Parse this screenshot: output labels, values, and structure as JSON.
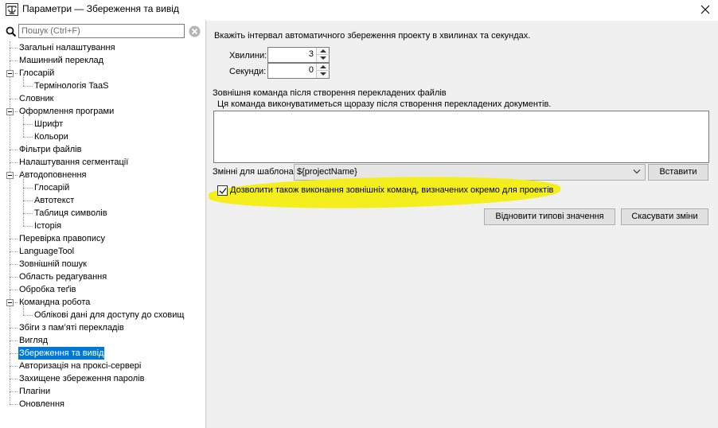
{
  "window": {
    "title": "Параметри — Збереження та вивід",
    "app_icon": "omegat-logo-icon",
    "close_icon": "close-icon"
  },
  "search": {
    "placeholder": "Пошук (Ctrl+F)",
    "value": "",
    "icon": "search-icon",
    "clear_icon": "clear-icon"
  },
  "tree": [
    {
      "label": "Загальні налаштування",
      "level": 0
    },
    {
      "label": "Машинний переклад",
      "level": 0
    },
    {
      "label": "Глосарій",
      "level": 0,
      "expanded": true
    },
    {
      "label": "Термінологія TaaS",
      "level": 1
    },
    {
      "label": "Словник",
      "level": 0
    },
    {
      "label": "Оформлення програми",
      "level": 0,
      "expanded": true
    },
    {
      "label": "Шрифт",
      "level": 1
    },
    {
      "label": "Кольори",
      "level": 1
    },
    {
      "label": "Фільтри файлів",
      "level": 0
    },
    {
      "label": "Налаштування сегментації",
      "level": 0
    },
    {
      "label": "Автодоповнення",
      "level": 0,
      "expanded": true
    },
    {
      "label": "Глосарій",
      "level": 1
    },
    {
      "label": "Автотекст",
      "level": 1
    },
    {
      "label": "Таблиця символів",
      "level": 1
    },
    {
      "label": "Історія",
      "level": 1
    },
    {
      "label": "Перевірка правопису",
      "level": 0
    },
    {
      "label": "LanguageTool",
      "level": 0
    },
    {
      "label": "Зовнішній пошук",
      "level": 0
    },
    {
      "label": "Область редагування",
      "level": 0
    },
    {
      "label": "Обробка теґів",
      "level": 0
    },
    {
      "label": "Командна робота",
      "level": 0,
      "expanded": true
    },
    {
      "label": "Облікові дані для доступу до сховищ",
      "level": 1
    },
    {
      "label": "Збіги з пам’яті перекладів",
      "level": 0
    },
    {
      "label": "Вигляд",
      "level": 0
    },
    {
      "label": "Збереження та вивід",
      "level": 0,
      "selected": true
    },
    {
      "label": "Авторизація на проксі-сервері",
      "level": 0
    },
    {
      "label": "Захищене збереження паролів",
      "level": 0
    },
    {
      "label": "Плагіни",
      "level": 0
    },
    {
      "label": "Оновлення",
      "level": 0
    }
  ],
  "autosave": {
    "description": "Вкажіть інтервал автоматичного збереження проекту в хвилинах та секундах.",
    "minutes_label": "Хвилини:",
    "minutes_value": "3",
    "seconds_label": "Секунди:",
    "seconds_value": "0"
  },
  "external_command": {
    "title": "Зовнішня команда після створення перекладених файлів",
    "note": "Ця команда виконуватиметься щоразу після створення перекладених документів.",
    "command_value": "",
    "variables_label": "Змінні для шаблона:",
    "variables_selected": "${projectName}",
    "insert_button": "Вставити",
    "allow_project_commands_label": "Дозволити також виконання зовнішніх команд, визначених окремо для проектів",
    "allow_project_commands_checked": true,
    "highlight_color": "#f4ef1c"
  },
  "footer": {
    "restore_defaults_button": "Відновити типові значення",
    "cancel_changes_button": "Скасувати зміни"
  },
  "colors": {
    "selection": "#0078d7",
    "panel_bg": "#f0f0f0"
  }
}
